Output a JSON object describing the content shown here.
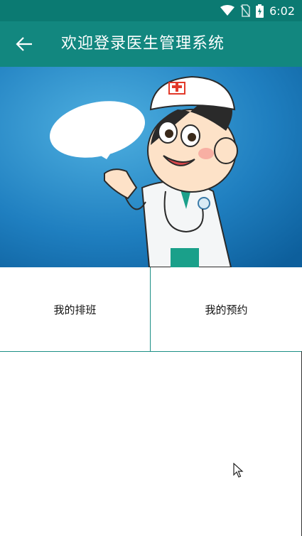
{
  "status_bar": {
    "time": "6:02",
    "icons": [
      "wifi-icon",
      "no-sim-icon",
      "battery-charging-icon"
    ]
  },
  "app_bar": {
    "back_icon": "arrow-back-icon",
    "title": "欢迎登录医生管理系统"
  },
  "banner": {
    "description_icon": "doctor-cartoon-illustration"
  },
  "menu": {
    "items": [
      {
        "label": "我的排班"
      },
      {
        "label": "我的预约"
      }
    ]
  },
  "colors": {
    "status_bar": "#0b7a72",
    "app_bar": "#12877f",
    "divider": "#1c8f86"
  }
}
